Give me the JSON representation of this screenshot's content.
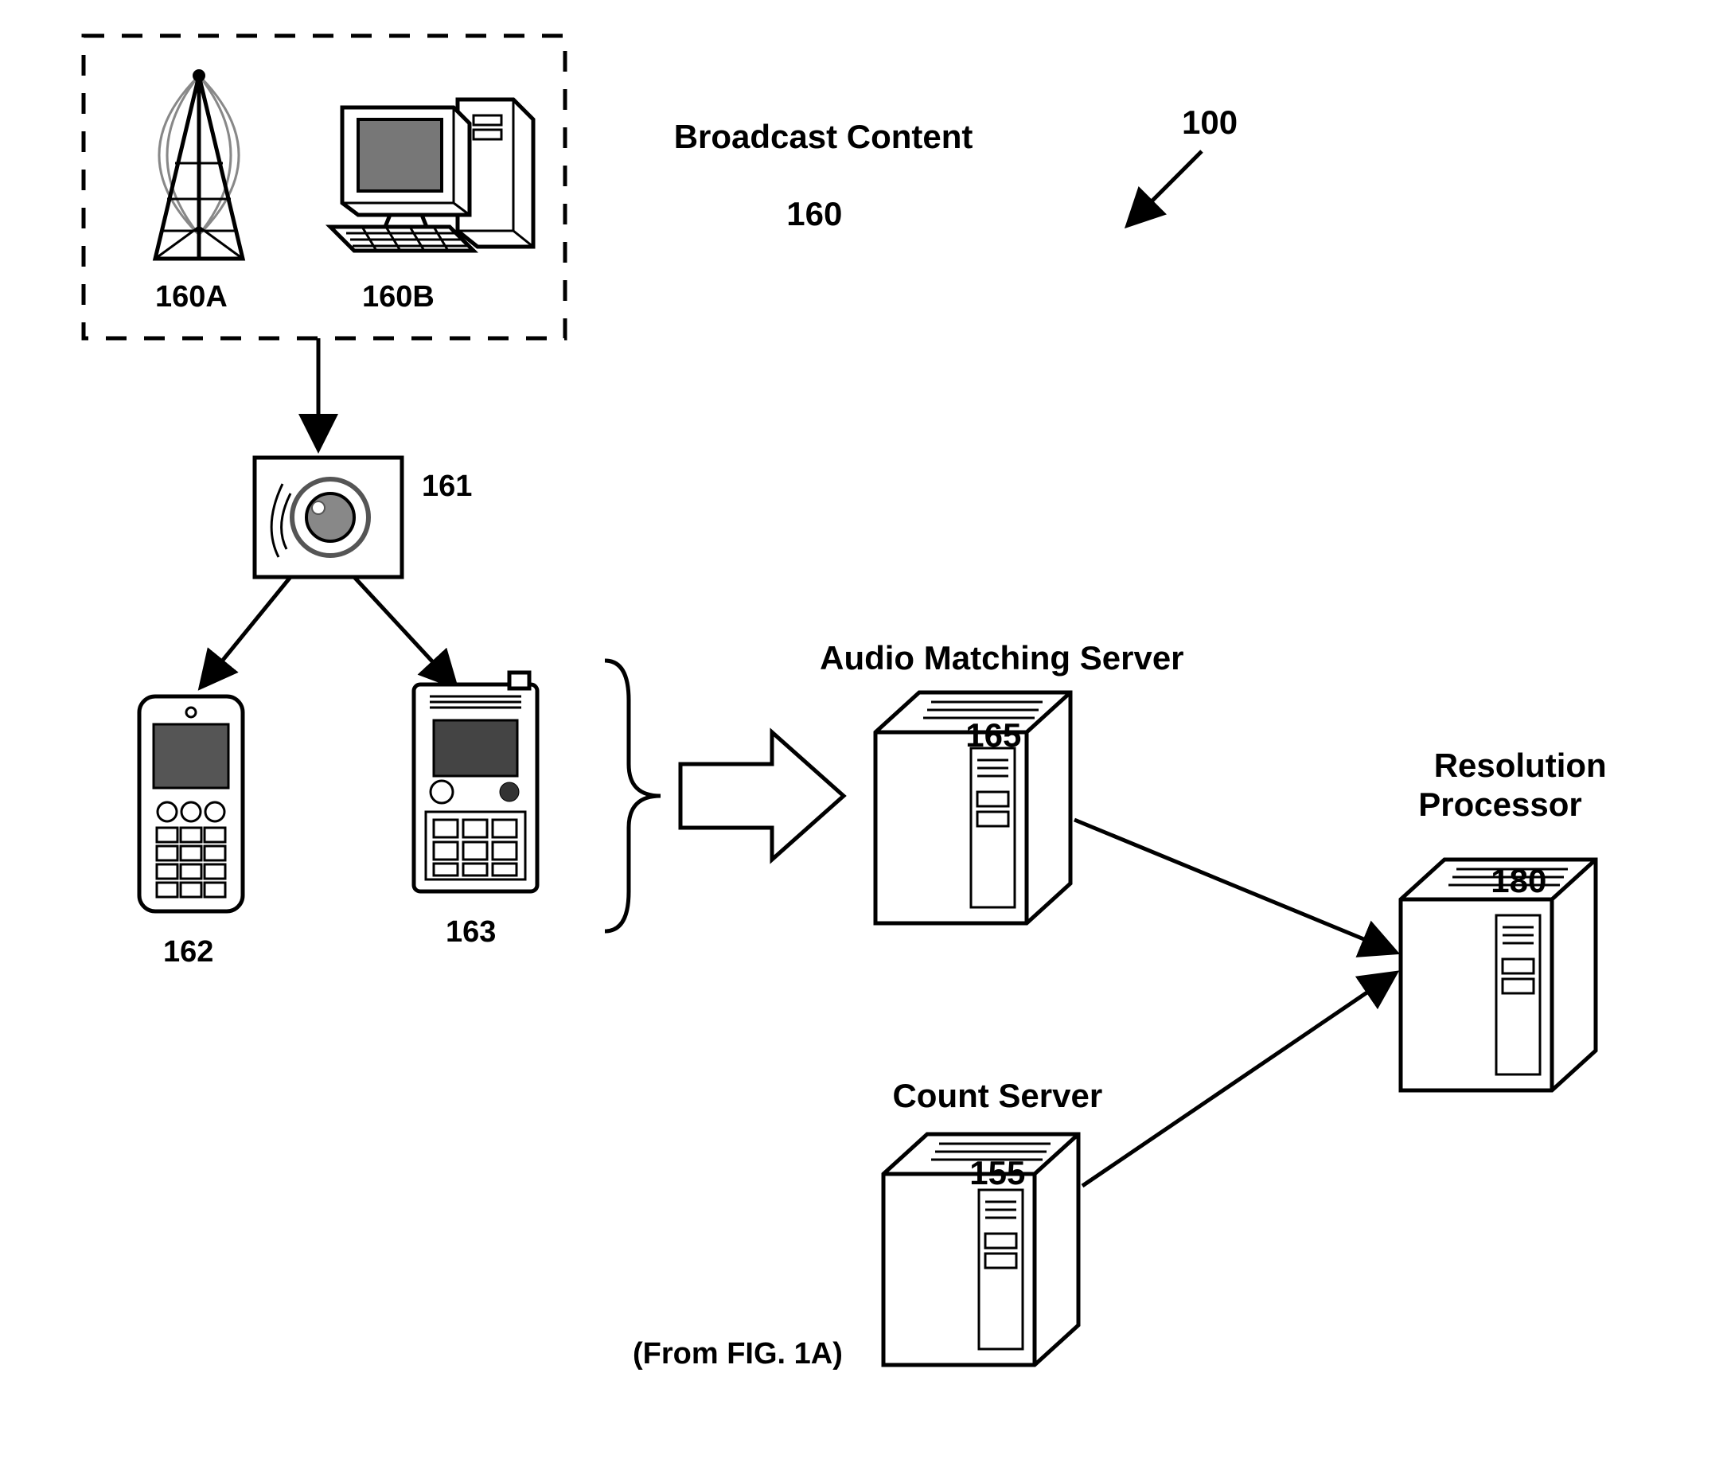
{
  "figure_ref": "100",
  "broadcast": {
    "title": "Broadcast Content",
    "ref": "160",
    "antenna_ref": "160A",
    "computer_ref": "160B"
  },
  "speaker_ref": "161",
  "phone_ref": "162",
  "media_player_ref": "163",
  "audio_matching": {
    "title": "Audio Matching Server",
    "ref": "165"
  },
  "count_server": {
    "title": "Count Server",
    "ref": "155",
    "note": "(From FIG. 1A)"
  },
  "resolution": {
    "title": "Resolution\nProcessor",
    "ref": "180"
  }
}
